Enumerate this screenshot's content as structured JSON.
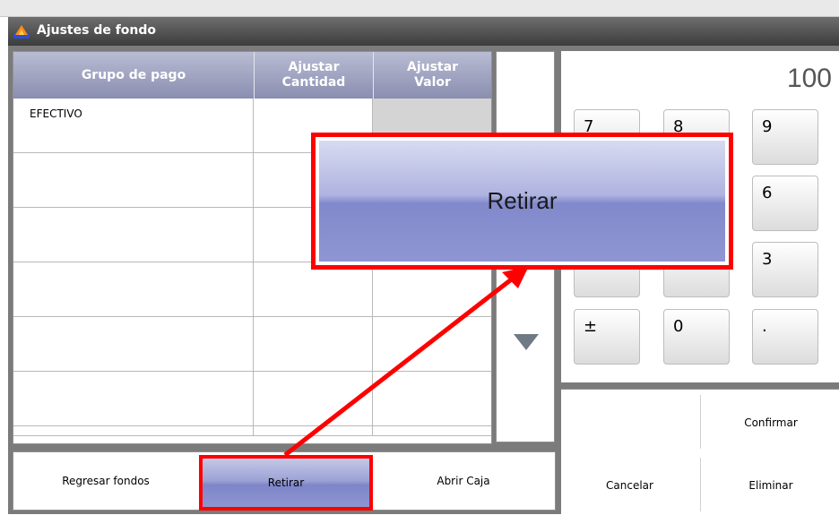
{
  "window": {
    "title": "Ajustes de fondo"
  },
  "grid": {
    "columns": [
      "Grupo de pago",
      "Ajustar\nCantidad",
      "Ajustar\nValor"
    ],
    "rows": [
      {
        "group": "EFECTIVO",
        "cantidad": "",
        "valor": ""
      },
      {
        "group": "",
        "cantidad": "",
        "valor": ""
      },
      {
        "group": "",
        "cantidad": "",
        "valor": ""
      },
      {
        "group": "",
        "cantidad": "",
        "valor": ""
      },
      {
        "group": "",
        "cantidad": "",
        "valor": ""
      },
      {
        "group": "",
        "cantidad": "",
        "valor": ""
      },
      {
        "group": "",
        "cantidad": "",
        "valor": ""
      }
    ]
  },
  "bottom": {
    "regresar": "Regresar fondos",
    "retirar": "Retirar",
    "abrir": "Abrir Caja"
  },
  "keypad": {
    "display": "100",
    "keys": [
      "7",
      "8",
      "9",
      "",
      "",
      "6",
      "",
      "",
      "3",
      "±",
      "0",
      "."
    ]
  },
  "actions": {
    "confirmar": "Confirmar",
    "cancelar": "Cancelar",
    "eliminar": "Eliminar"
  },
  "callout": {
    "label": "Retirar",
    "color": "#ff0000"
  }
}
